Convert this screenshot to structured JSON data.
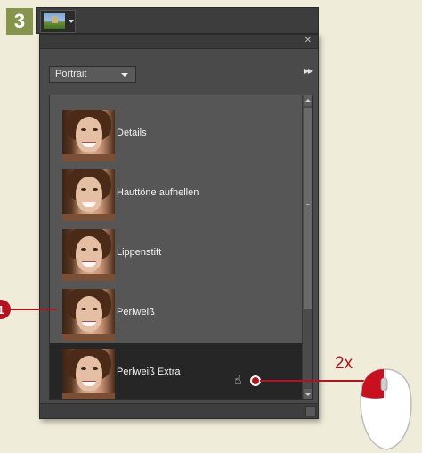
{
  "step": {
    "number": "3"
  },
  "panel": {
    "dropdown": {
      "value": "Portrait"
    },
    "items": [
      {
        "label": "Details",
        "selected": false
      },
      {
        "label": "Hauttöne aufhellen",
        "selected": false
      },
      {
        "label": "Lippenstift",
        "selected": false
      },
      {
        "label": "Perlweiß",
        "selected": false
      },
      {
        "label": "Perlweiß Extra",
        "selected": true
      }
    ]
  },
  "annotations": {
    "callout_number": "1",
    "double_click_label": "2x"
  },
  "icons": [
    "close-icon",
    "panel-menu-icon",
    "chevron-down-icon",
    "hand-cursor-icon",
    "mouse-icon"
  ],
  "colors": {
    "accent_red": "#b3121e",
    "step_badge": "#86944e",
    "panel_bg": "#4a4a4a",
    "selected_bg": "#262626"
  }
}
